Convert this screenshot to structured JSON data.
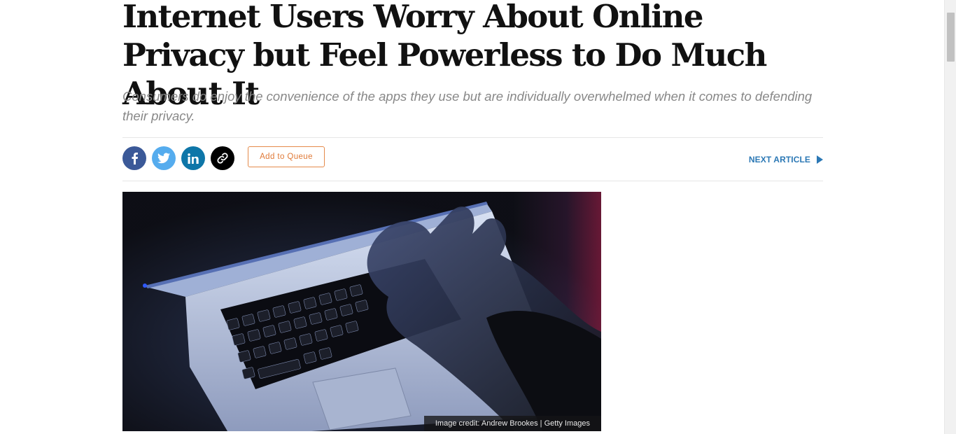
{
  "article": {
    "headline": "Internet Users Worry About Online Privacy but Feel Powerless to Do Much About It",
    "subhead": "Consumers do enjoy the convenience of the apps they use but are individually overwhelmed when it comes to defending their privacy."
  },
  "share_bar": {
    "icons": [
      "facebook-icon",
      "twitter-icon",
      "linkedin-icon",
      "link-icon"
    ],
    "colors": {
      "facebook": "#3b5998",
      "twitter": "#55acee",
      "linkedin": "#0e76a8",
      "link": "#000000"
    },
    "queue_label": "Add to Queue",
    "next_label": "NEXT ARTICLE",
    "accent": "#2b78b5",
    "queue_accent": "#e07a38"
  },
  "hero": {
    "credit": "Image credit: Andrew Brookes | Getty Images"
  }
}
